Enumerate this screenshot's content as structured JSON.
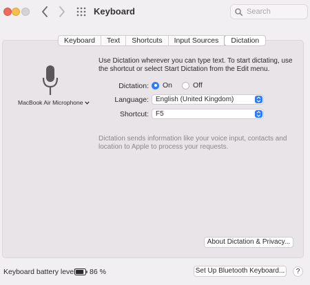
{
  "window": {
    "title": "Keyboard",
    "search_placeholder": "Search"
  },
  "tabs": [
    {
      "label": "Keyboard"
    },
    {
      "label": "Text"
    },
    {
      "label": "Shortcuts"
    },
    {
      "label": "Input Sources"
    },
    {
      "label": "Dictation",
      "active": true
    }
  ],
  "dictation": {
    "description": "Use Dictation wherever you can type text. To start dictating, use the shortcut or select Start Dictation from the Edit menu.",
    "mic_source": "MacBook Air Microphone",
    "dictation_label": "Dictation:",
    "radio_on": "On",
    "radio_off": "Off",
    "dictation_value": "On",
    "language_label": "Language:",
    "language_value": "English (United Kingdom)",
    "shortcut_label": "Shortcut:",
    "shortcut_value": "F5",
    "note": "Dictation sends information like your voice input, contacts and location to Apple to process your requests.",
    "about_button": "About Dictation & Privacy..."
  },
  "footer": {
    "battery_label": "Keyboard battery level:",
    "battery_pct": "86 %",
    "battery_level": 0.86,
    "bluetooth_button": "Set Up Bluetooth Keyboard...",
    "help_button": "?"
  },
  "colors": {
    "accent": "#2f7cf6",
    "close": "#ed6a5e",
    "minimize": "#f4bf4f"
  }
}
